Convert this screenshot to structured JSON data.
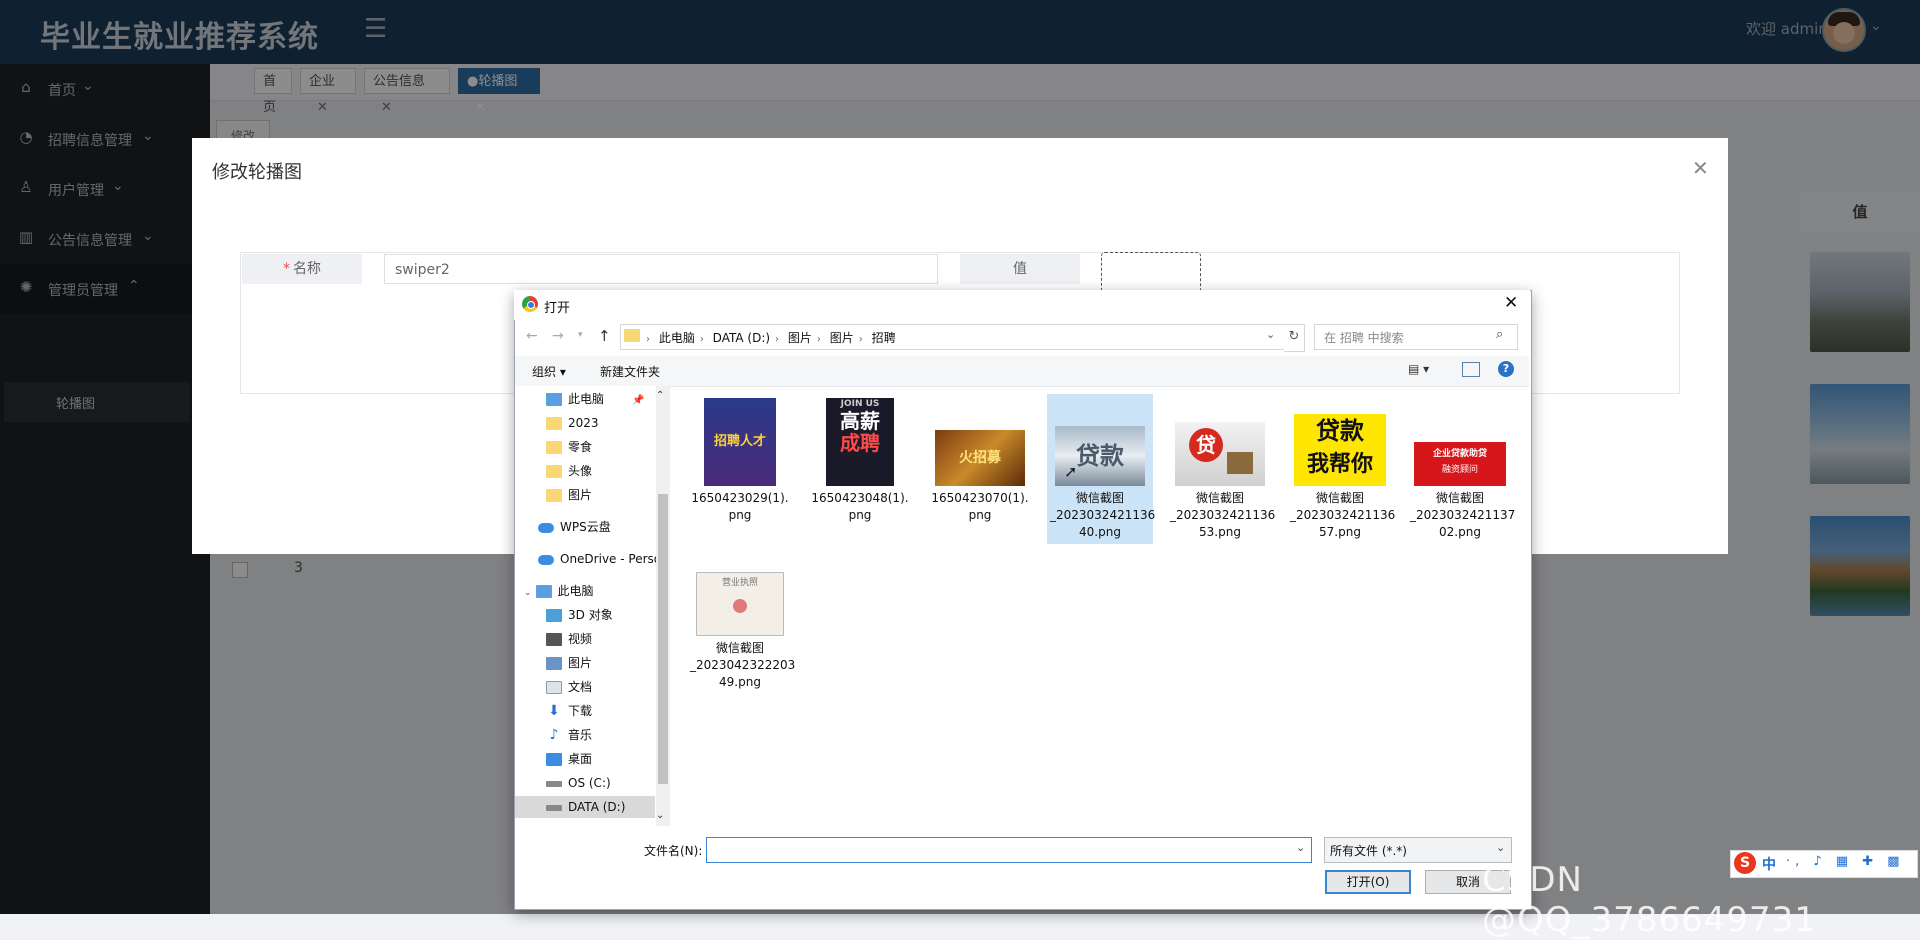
{
  "app": {
    "title": "毕业生就业推荐系统",
    "welcome": "欢迎 admin"
  },
  "sidebar": {
    "items": [
      {
        "label": "首页",
        "icon": "home-icon"
      },
      {
        "label": "招聘信息管理",
        "icon": "speedometer-icon"
      },
      {
        "label": "用户管理",
        "icon": "user-icon"
      },
      {
        "label": "公告信息管理",
        "icon": "chart-icon"
      },
      {
        "label": "管理员管理",
        "icon": "gear-icon"
      }
    ],
    "subitem": "轮播图"
  },
  "tabs": [
    {
      "label": "首页"
    },
    {
      "label": "企业"
    },
    {
      "label": "公告信息"
    },
    {
      "label": "●轮播图"
    }
  ],
  "background": {
    "edit_button": "修改",
    "value_header": "值",
    "row_num": "3"
  },
  "modal": {
    "title": "修改轮播图",
    "name_label": "名称",
    "name_value": "swiper2",
    "value_label": "值"
  },
  "file_dialog": {
    "title": "打开",
    "path": [
      "此电脑",
      "DATA (D:)",
      "图片",
      "图片",
      "招聘"
    ],
    "search_placeholder": "在 招聘 中搜索",
    "organize": "组织 ▾",
    "new_folder": "新建文件夹",
    "help": "?",
    "tree": [
      {
        "label": "此电脑",
        "type": "pc"
      },
      {
        "label": "2023",
        "type": "folder"
      },
      {
        "label": "零食",
        "type": "folder"
      },
      {
        "label": "头像",
        "type": "folder"
      },
      {
        "label": "图片",
        "type": "folder"
      },
      {
        "label": "WPS云盘",
        "type": "cloud"
      },
      {
        "label": "OneDrive - Perso",
        "type": "cloud"
      },
      {
        "label": "此电脑",
        "type": "pc"
      },
      {
        "label": "3D 对象",
        "type": "obj3d"
      },
      {
        "label": "视频",
        "type": "video"
      },
      {
        "label": "图片",
        "type": "pictures"
      },
      {
        "label": "文档",
        "type": "document"
      },
      {
        "label": "下载",
        "type": "download"
      },
      {
        "label": "音乐",
        "type": "music"
      },
      {
        "label": "桌面",
        "type": "desktop"
      },
      {
        "label": "OS (C:)",
        "type": "drive"
      },
      {
        "label": "DATA (D:)",
        "type": "drive"
      }
    ],
    "files": [
      {
        "line1": "1650423029(1).",
        "line2": "png",
        "line3": ""
      },
      {
        "line1": "1650423048(1).",
        "line2": "png",
        "line3": ""
      },
      {
        "line1": "1650423070(1).",
        "line2": "png",
        "line3": ""
      },
      {
        "line1": "微信截图",
        "line2": "_2023032421136",
        "line3": "40.png"
      },
      {
        "line1": "微信截图",
        "line2": "_2023032421136",
        "line3": "53.png"
      },
      {
        "line1": "微信截图",
        "line2": "_2023032421136",
        "line3": "57.png"
      },
      {
        "line1": "微信截图",
        "line2": "_2023032421137",
        "line3": "02.png"
      },
      {
        "line1": "微信截图",
        "line2": "_2023042322203",
        "line3": "49.png"
      }
    ],
    "thumb_texts": {
      "t1": "招聘人才",
      "t2_top": "JOIN US",
      "t2a": "高薪",
      "t2b": "成聘",
      "t3": "火招募",
      "t4": "贷款",
      "t5": "贷",
      "t6a": "贷款",
      "t6b": "我帮你",
      "t7a": "企业贷款助贷",
      "t7b": "融资顾问",
      "t8": "营业执照"
    },
    "filename_label": "文件名(N):",
    "filename_value": "",
    "filetype": "所有文件 (*.*)",
    "open_button": "打开(O)",
    "cancel_button": "取消"
  },
  "watermark": "CSDN @QQ_3786649731",
  "ime": {
    "logo": "S",
    "mode": "中",
    "tools": "·, ♪ ▦ ✚ ▩"
  },
  "colors": {
    "header": "#1d3b5a",
    "sidebar": "#1e2226",
    "accent": "#2f6ea6",
    "selection": "#cce4f7"
  }
}
